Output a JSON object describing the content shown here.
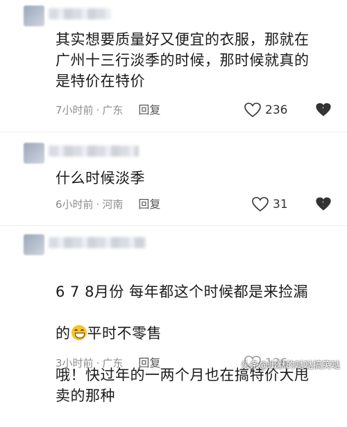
{
  "comments": [
    {
      "text": "其实想要质量好又便宜的衣服，那就在\n广州十三行淡季的时候，那时候就真的\n是特价在特价",
      "time": "7小时前",
      "location": "广东",
      "reply_label": "回复",
      "likes": "236"
    },
    {
      "text": "什么时候淡季",
      "time": "6小时前",
      "location": "河南",
      "reply_label": "回复",
      "likes": "31"
    },
    {
      "text_line1": "6 7 8月份 每年都这个时候都是来捡漏",
      "text_line2_a": "的",
      "text_line2_b": "平时不零售",
      "text_line3": "哦！快过年的一两个月也在搞特价大甩\n卖的那种",
      "time": "3小时前",
      "location": "广东",
      "reply_label": "回复",
      "likes": "126"
    }
  ],
  "separator": "·",
  "icons": {
    "like": "heart-outline-icon",
    "dislike": "broken-heart-icon",
    "emoji": "grinning-face-emoji"
  },
  "watermark": "头条@幽默的哒哒搞笑哒"
}
